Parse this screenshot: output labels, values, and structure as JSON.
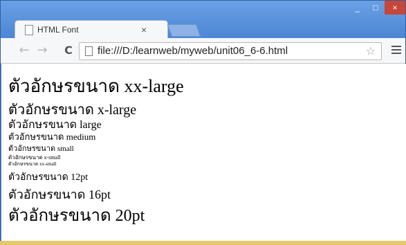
{
  "browser": {
    "tab_title": "HTML Font",
    "tab_close": "×",
    "url": "file:///D:/learnweb/myweb/unit06_6-6.html",
    "window_controls": {
      "minimize": "_",
      "maximize": "□",
      "close": "×"
    },
    "nav": {
      "back": "←",
      "forward": "→",
      "reload": "C"
    },
    "star": "☆"
  },
  "content": {
    "lines": [
      {
        "thai": "ตัวอักษรขนาด",
        "label": "xx-large"
      },
      {
        "thai": "ตัวอักษรขนาด",
        "label": "x-large"
      },
      {
        "thai": "ตัวอักษรขนาด",
        "label": "large"
      },
      {
        "thai": "ตัวอักษรขนาด",
        "label": "medium"
      },
      {
        "thai": "ตัวอักษรขนาด",
        "label": "small"
      },
      {
        "thai": "ตัวอักษรขนาด",
        "label": "x-small"
      },
      {
        "thai": "ตัวอักษรขนาด",
        "label": "xx-small"
      },
      {
        "thai": "ตัวอักษรขนาด",
        "label": "12pt"
      },
      {
        "thai": "ตัวอักษรขนาด",
        "label": "16pt"
      },
      {
        "thai": "ตัวอักษรขนาด",
        "label": "20pt"
      }
    ]
  },
  "colors": {
    "titlebar": "#4c86d3",
    "close_button": "#c7463a",
    "toolbar": "#f6f7f9"
  }
}
